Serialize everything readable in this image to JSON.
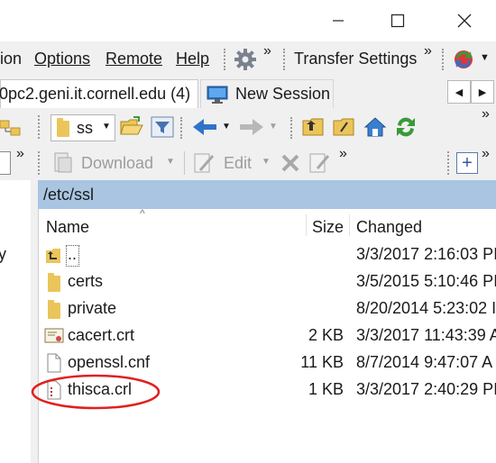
{
  "window": {
    "minimize_glyph": "—",
    "maximize_glyph": "☐",
    "close_glyph": "✕"
  },
  "menu": {
    "items": [
      "ion",
      "Options",
      "Remote",
      "Help"
    ],
    "transfer_settings": "Transfer Settings",
    "overflow": "»"
  },
  "tabs": {
    "session": "0pc2.geni.it.cornell.edu (4)",
    "new_session": "New Session",
    "left_arrow": "◀",
    "right_arrow": "▶"
  },
  "toolbar1": {
    "path_value": "ss",
    "overflow": "»"
  },
  "toolbar2": {
    "download": "Download",
    "edit": "Edit",
    "overflow": "»",
    "plus": "+"
  },
  "left_panel": {
    "fragment": "y"
  },
  "remote": {
    "path": "/etc/ssl",
    "columns": {
      "name": "Name",
      "size": "Size",
      "changed": "Changed"
    },
    "rows": [
      {
        "name": "..",
        "size": "",
        "changed": "3/3/2017 2:16:03 PI",
        "icon": "parent-dir-icon"
      },
      {
        "name": "certs",
        "size": "",
        "changed": "3/5/2015 5:10:46 PI",
        "icon": "folder-icon"
      },
      {
        "name": "private",
        "size": "",
        "changed": "8/20/2014 5:23:02 I",
        "icon": "folder-icon"
      },
      {
        "name": "cacert.crt",
        "size": "2 KB",
        "changed": "3/3/2017 11:43:39 A",
        "icon": "certificate-icon"
      },
      {
        "name": "openssl.cnf",
        "size": "11 KB",
        "changed": "8/7/2014 9:47:07 A",
        "icon": "file-icon"
      },
      {
        "name": "thisca.crl",
        "size": "1 KB",
        "changed": "3/3/2017 2:40:29 PI",
        "icon": "crl-file-icon"
      }
    ],
    "highlight_color": "#e02020"
  }
}
